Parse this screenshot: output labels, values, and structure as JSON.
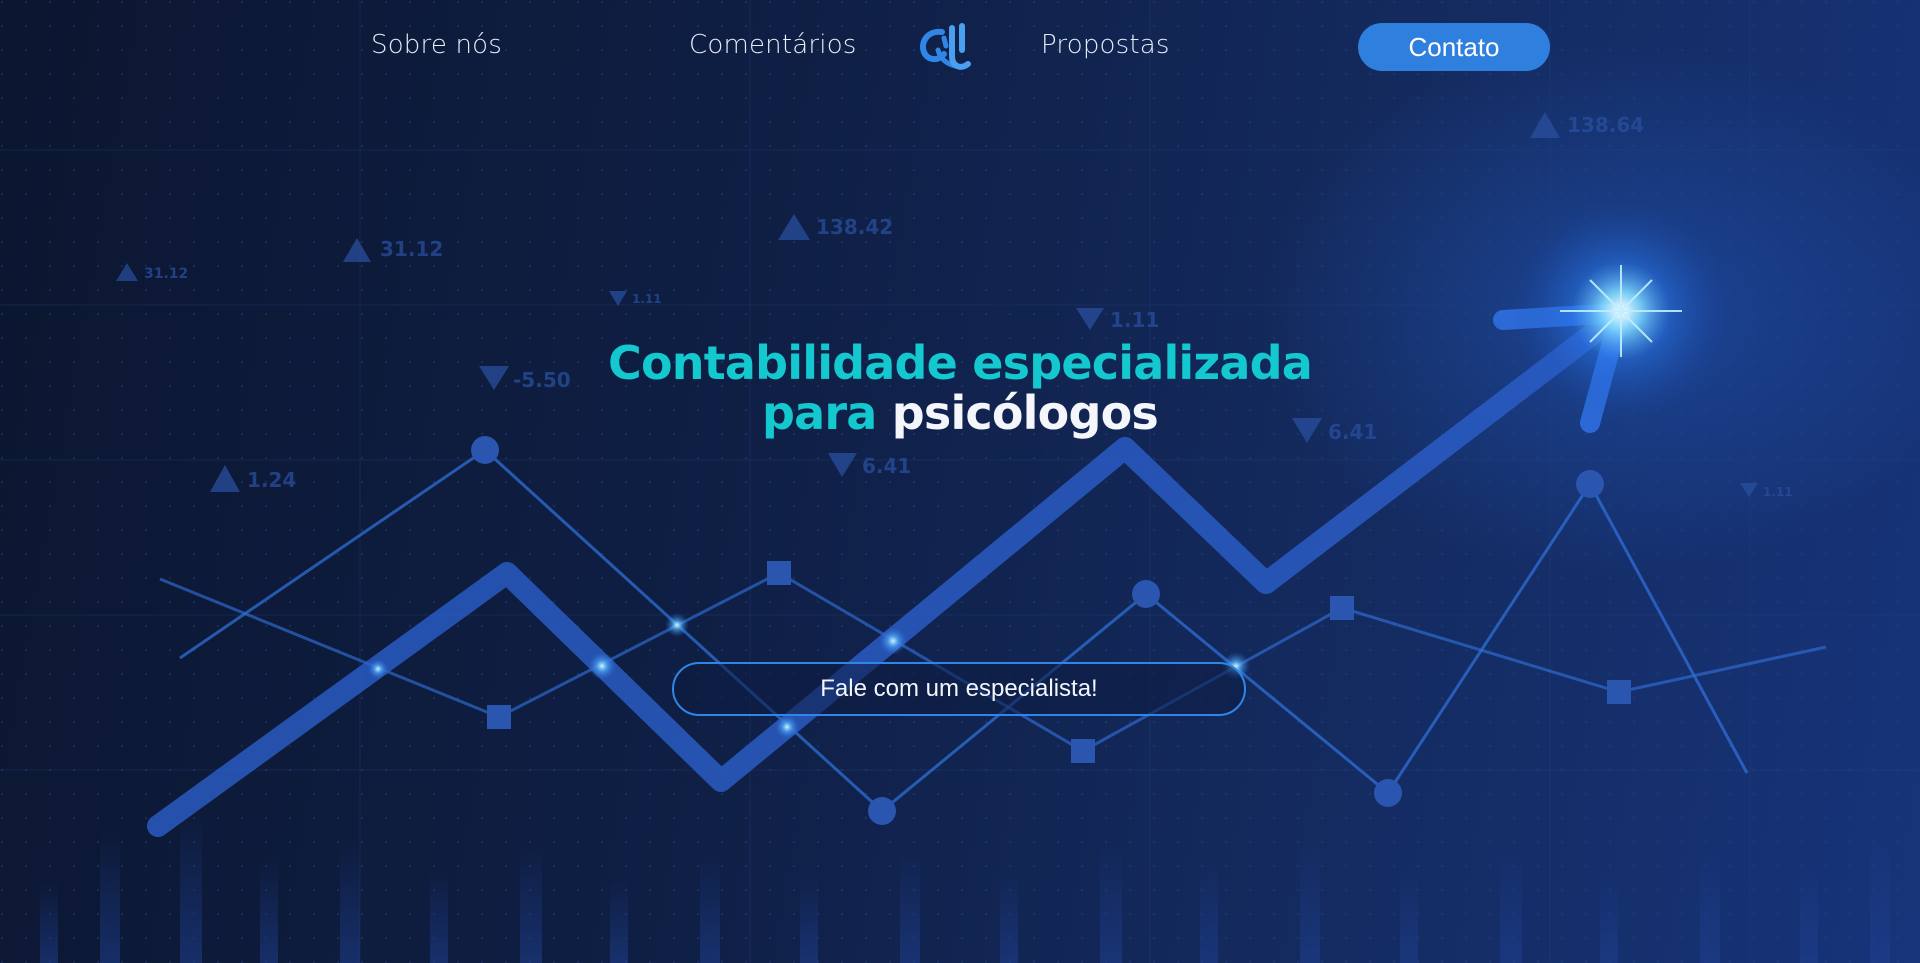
{
  "nav": {
    "links": [
      {
        "label": "Sobre nós"
      },
      {
        "label": "Comentários"
      },
      {
        "label": "Propostas"
      }
    ],
    "contact_label": "Contato"
  },
  "hero": {
    "headline_line1": "Contabilidade especializada",
    "headline_line2_accent": "para",
    "headline_line2_main": "psicólogos",
    "cta_label": "Fale com um especialista!"
  },
  "background_tickers": [
    {
      "symbol": "up",
      "value": "138.64"
    },
    {
      "symbol": "up",
      "value": "138.42"
    },
    {
      "symbol": "up",
      "value": "31.12"
    },
    {
      "symbol": "up",
      "value": "31.12"
    },
    {
      "symbol": "down",
      "value": "1.11"
    },
    {
      "symbol": "down",
      "value": "1.11"
    },
    {
      "symbol": "down",
      "value": "-5.50"
    },
    {
      "symbol": "up",
      "value": "1.24"
    },
    {
      "symbol": "down",
      "value": "6.41"
    },
    {
      "symbol": "down",
      "value": "6.41"
    },
    {
      "symbol": "down",
      "value": "1.11"
    }
  ],
  "colors": {
    "accent_teal": "#14c8cf",
    "button_blue": "#2f7fde",
    "background_dark": "#0d1a3a"
  }
}
